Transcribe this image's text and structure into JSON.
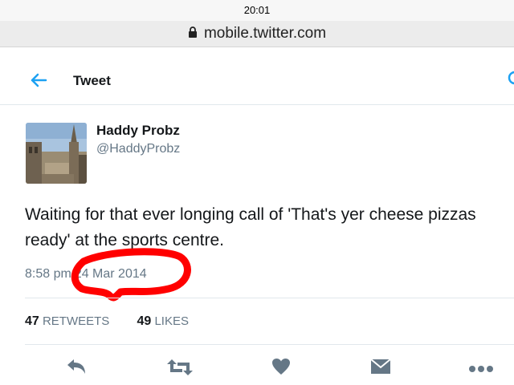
{
  "status_bar": {
    "time": "20:01"
  },
  "url_bar": {
    "url": "mobile.twitter.com"
  },
  "header": {
    "title": "Tweet"
  },
  "tweet": {
    "author_name": "Haddy Probz",
    "author_handle": "@HaddyProbz",
    "text": "Waiting for that ever longing call of 'That's yer cheese pizzas ready' at the sports centre.",
    "time": "8:58 pm",
    "date": "24 Mar 2014"
  },
  "stats": {
    "retweets_count": "47",
    "retweets_label": "RETWEETS",
    "likes_count": "49",
    "likes_label": "LIKES"
  },
  "colors": {
    "accent": "#1da1f2",
    "muted": "#657786",
    "annotation": "#ff0000"
  },
  "icons": [
    "lock-icon",
    "back-arrow-icon",
    "search-icon",
    "reply-icon",
    "retweet-icon",
    "like-icon",
    "message-icon",
    "more-icon"
  ]
}
